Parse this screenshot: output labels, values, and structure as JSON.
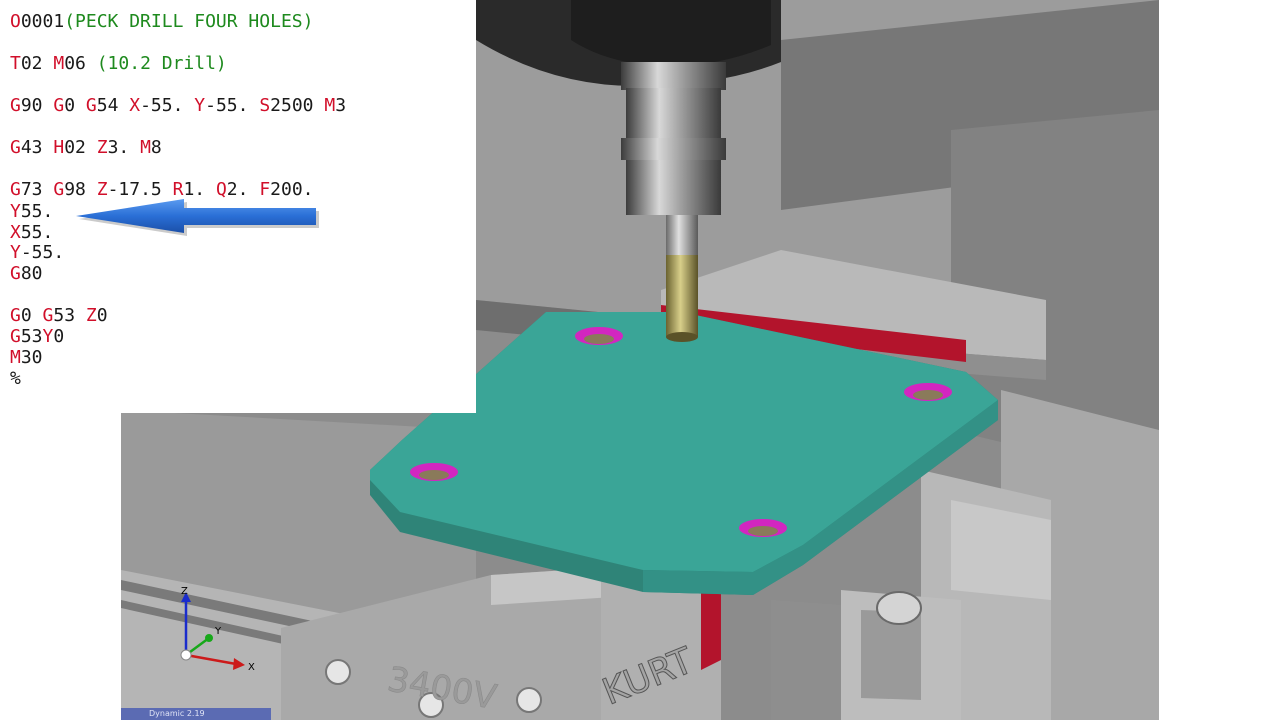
{
  "code_lines": [
    [
      {
        "t": "O",
        "c": "addr"
      },
      {
        "t": "0001"
      },
      {
        "t": "(PECK DRILL FOUR HOLES)",
        "c": "cmt"
      }
    ],
    [
      {
        "t": "T",
        "c": "addr"
      },
      {
        "t": "02 "
      },
      {
        "t": "M",
        "c": "addr"
      },
      {
        "t": "06 "
      },
      {
        "t": "(10.2 Drill)",
        "c": "cmt"
      }
    ],
    [
      {
        "t": "G",
        "c": "addr"
      },
      {
        "t": "90 "
      },
      {
        "t": "G",
        "c": "addr"
      },
      {
        "t": "0 "
      },
      {
        "t": "G",
        "c": "addr"
      },
      {
        "t": "54 "
      },
      {
        "t": "X",
        "c": "addr"
      },
      {
        "t": "-55. "
      },
      {
        "t": "Y",
        "c": "addr"
      },
      {
        "t": "-55. "
      },
      {
        "t": "S",
        "c": "addr"
      },
      {
        "t": "2500 "
      },
      {
        "t": "M",
        "c": "addr"
      },
      {
        "t": "3"
      }
    ],
    [
      {
        "t": "G",
        "c": "addr"
      },
      {
        "t": "43 "
      },
      {
        "t": "H",
        "c": "addr"
      },
      {
        "t": "02 "
      },
      {
        "t": "Z",
        "c": "addr"
      },
      {
        "t": "3. "
      },
      {
        "t": "M",
        "c": "addr"
      },
      {
        "t": "8"
      }
    ],
    [
      {
        "t": "G",
        "c": "addr"
      },
      {
        "t": "73 "
      },
      {
        "t": "G",
        "c": "addr"
      },
      {
        "t": "98 "
      },
      {
        "t": "Z",
        "c": "addr"
      },
      {
        "t": "-17.5 "
      },
      {
        "t": "R",
        "c": "addr"
      },
      {
        "t": "1. "
      },
      {
        "t": "Q",
        "c": "addr"
      },
      {
        "t": "2. "
      },
      {
        "t": "F",
        "c": "addr"
      },
      {
        "t": "200."
      }
    ],
    [
      {
        "t": "Y",
        "c": "addr"
      },
      {
        "t": "55."
      }
    ],
    [
      {
        "t": "X",
        "c": "addr"
      },
      {
        "t": "55."
      }
    ],
    [
      {
        "t": "Y",
        "c": "addr"
      },
      {
        "t": "-55."
      }
    ],
    [
      {
        "t": "G",
        "c": "addr"
      },
      {
        "t": "80"
      }
    ],
    [
      {
        "t": "G",
        "c": "addr"
      },
      {
        "t": "0 "
      },
      {
        "t": "G",
        "c": "addr"
      },
      {
        "t": "53 "
      },
      {
        "t": "Z",
        "c": "addr"
      },
      {
        "t": "0"
      }
    ],
    [
      {
        "t": "G",
        "c": "addr"
      },
      {
        "t": "53"
      },
      {
        "t": "Y",
        "c": "addr"
      },
      {
        "t": "0"
      }
    ],
    [
      {
        "t": "M",
        "c": "addr"
      },
      {
        "t": "30"
      }
    ],
    [
      {
        "t": "%"
      }
    ]
  ],
  "arrow_target_line": 6,
  "scene": {
    "vise_front_text": "3400V",
    "vise_brand": "KURT",
    "axis_labels": {
      "x": "X",
      "y": "Y",
      "z": "Z"
    }
  },
  "status": {
    "text": "Dynamic 2.19"
  },
  "colors": {
    "address": "#d10f2a",
    "comment": "#1e8a1e",
    "workpiece": "#3aa597",
    "parallel": "#b3142c",
    "hole": "#d226c0",
    "arrow": "#2a6fd6"
  }
}
